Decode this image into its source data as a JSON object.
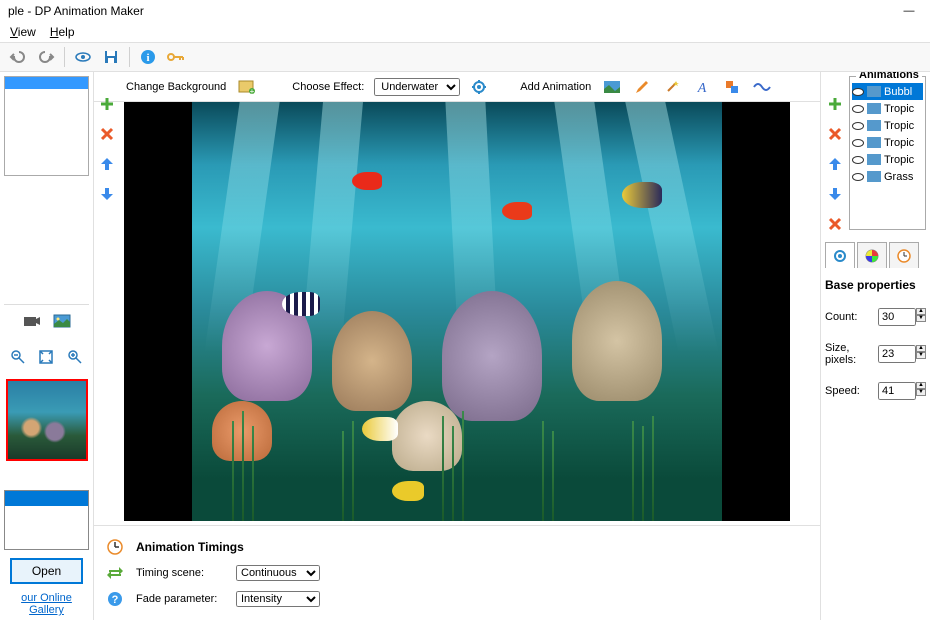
{
  "window": {
    "title": "ple - DP Animation Maker"
  },
  "menu": {
    "view": "View",
    "help": "Help"
  },
  "left": {
    "open": "Open",
    "gallery": "our Online Gallery"
  },
  "center_toolbar": {
    "change_bg": "Change Background",
    "choose_effect": "Choose Effect:",
    "effect_selected": "Underwater",
    "add_animation": "Add Animation"
  },
  "timings": {
    "heading": "Animation Timings",
    "scene_label": "Timing scene:",
    "scene_value": "Continuous",
    "fade_label": "Fade parameter:",
    "fade_value": "Intensity"
  },
  "animations": {
    "heading": "Animations",
    "items": [
      {
        "label": "Bubbl"
      },
      {
        "label": "Tropic"
      },
      {
        "label": "Tropic"
      },
      {
        "label": "Tropic"
      },
      {
        "label": "Tropic"
      },
      {
        "label": "Grass"
      }
    ]
  },
  "props": {
    "heading": "Base properties",
    "count_label": "Count:",
    "count_value": "30",
    "size_label": "Size, pixels:",
    "size_value": "23",
    "speed_label": "Speed:",
    "speed_value": "41"
  }
}
